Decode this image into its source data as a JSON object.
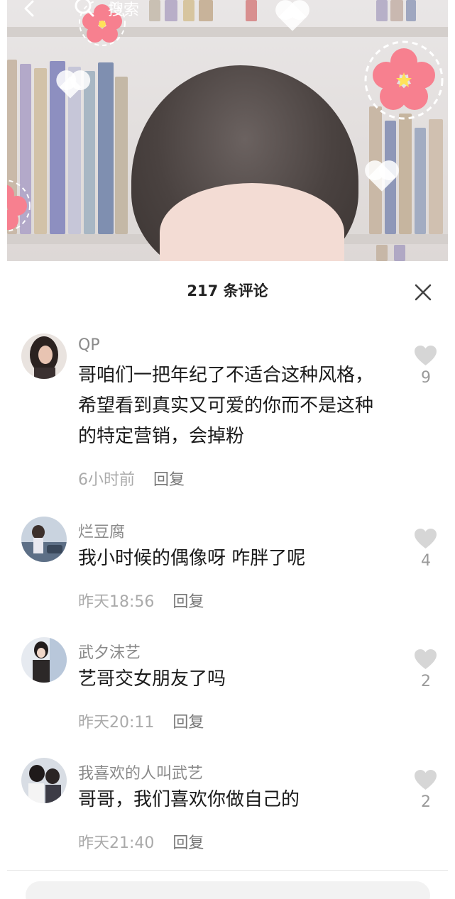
{
  "topbar": {
    "search_label": "搜索",
    "back_icon": "back-arrow-icon",
    "search_icon": "search-icon"
  },
  "comments_panel": {
    "title": "217 条评论",
    "close_icon": "close-icon",
    "comments": [
      {
        "username": "QP",
        "text": "哥咱们一把年纪了不适合这种风格，希望看到真实又可爱的你而不是这种的特定营销，会掉粉",
        "time": "6小时前",
        "reply_label": "回复",
        "likes": "9"
      },
      {
        "username": "烂豆腐",
        "text": "我小时候的偶像呀 咋胖了呢",
        "time": "昨天18:56",
        "reply_label": "回复",
        "likes": "4"
      },
      {
        "username": "武夕沫艺",
        "text": "艺哥交女朋友了吗",
        "time": "昨天20:11",
        "reply_label": "回复",
        "likes": "2"
      },
      {
        "username": "我喜欢的人叫武艺",
        "text": "哥哥，我们喜欢你做自己的",
        "time": "昨天21:40",
        "reply_label": "回复",
        "likes": "2"
      }
    ]
  },
  "colors": {
    "like_icon": "#d4d4d4",
    "meta_text": "#aaaaaa",
    "flower": "#f7808f"
  }
}
